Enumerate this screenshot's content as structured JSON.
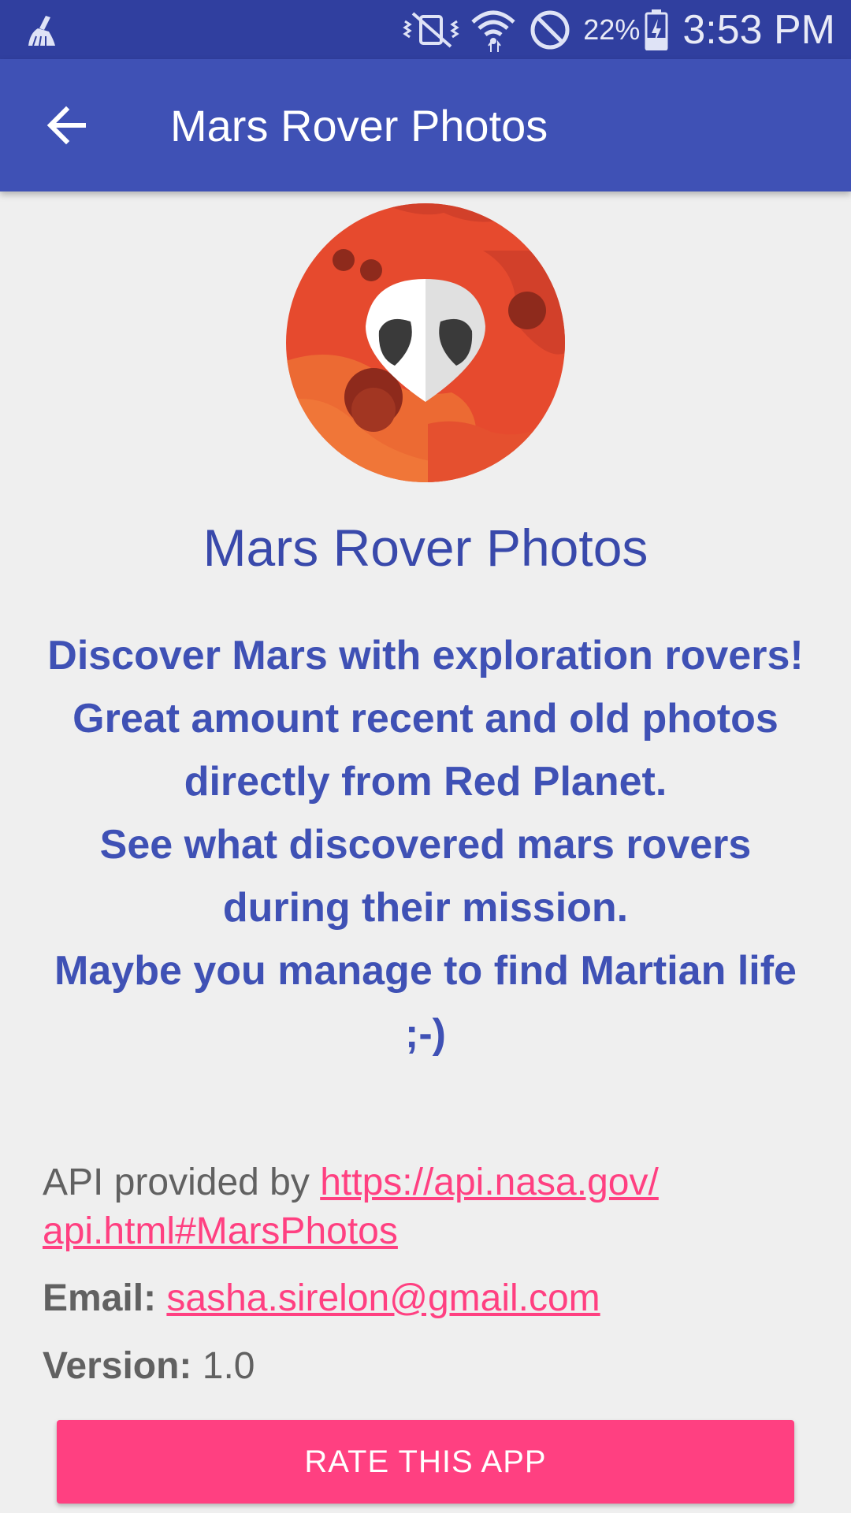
{
  "status_bar": {
    "battery_percent": "22%",
    "time": "3:53 PM",
    "icons": [
      "cleaner-icon",
      "vibrate-mute-icon",
      "wifi-icon",
      "do-not-disturb-icon",
      "battery-charging-icon"
    ]
  },
  "toolbar": {
    "title": "Mars Rover Photos",
    "back_icon": "arrow-back-icon"
  },
  "app_name": "Mars Rover Photos",
  "description": {
    "line1": "Discover Mars with exploration rovers!",
    "line2": "Great amount recent and old photos directly from Red Planet.",
    "line3": "See what discovered mars rovers during their mission.",
    "line4": "Maybe you  manage to find Martian life ;-)"
  },
  "api": {
    "prefix": "API provided by ",
    "url_part1": "https://api.nasa.gov/",
    "url_part2": "api.html#MarsPhotos"
  },
  "email": {
    "label": "Email:",
    "value": "sasha.sirelon@gmail.com"
  },
  "version": {
    "label": "Version:",
    "value": "1.0"
  },
  "rate_button": "RATE THIS APP",
  "colors": {
    "status_bar": "#303f9f",
    "primary": "#3f51b5",
    "accent": "#ff4081",
    "background": "#efefef"
  }
}
